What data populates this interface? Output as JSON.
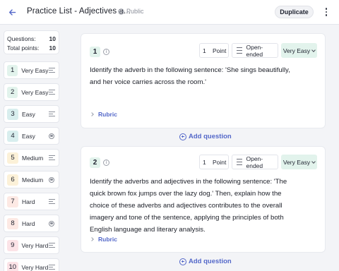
{
  "header": {
    "title": "Practice List - Adjectives a...",
    "visibility": "Public",
    "duplicate_label": "Duplicate"
  },
  "stats": {
    "questions_label": "Questions:",
    "questions_value": "10",
    "points_label": "Total points:",
    "points_value": "10"
  },
  "sidebar": {
    "items": [
      {
        "num": "1",
        "difficulty": "Very Easy",
        "icon": "lines-icon",
        "color": "#e2f3ec"
      },
      {
        "num": "2",
        "difficulty": "Very Easy",
        "icon": "lines-icon",
        "color": "#e2f3ec"
      },
      {
        "num": "3",
        "difficulty": "Easy",
        "icon": "lines-icon",
        "color": "#d8eeee"
      },
      {
        "num": "4",
        "difficulty": "Easy",
        "icon": "radio-icon",
        "color": "#d8eeee"
      },
      {
        "num": "5",
        "difficulty": "Medium",
        "icon": "lines-icon",
        "color": "#fcf1d8"
      },
      {
        "num": "6",
        "difficulty": "Medium",
        "icon": "radio-icon",
        "color": "#fcf1d8"
      },
      {
        "num": "7",
        "difficulty": "Hard",
        "icon": "lines-icon",
        "color": "#fde9e4"
      },
      {
        "num": "8",
        "difficulty": "Hard",
        "icon": "radio-icon",
        "color": "#fde9e4"
      },
      {
        "num": "9",
        "difficulty": "Very Hard",
        "icon": "lines-icon",
        "color": "#fce3e7"
      },
      {
        "num": "10",
        "difficulty": "Very Hard",
        "icon": "lines-icon",
        "color": "#fce3e7"
      }
    ]
  },
  "questions": [
    {
      "num": "1",
      "points_value": "1",
      "points_label": "Point",
      "type": "Open-ended",
      "difficulty": "Very Easy",
      "text": "Identify the adverb in the following sentence: 'She sings beautifully, and her voice carries across the room.'",
      "rubric_label": "Rubric"
    },
    {
      "num": "2",
      "points_value": "1",
      "points_label": "Point",
      "type": "Open-ended",
      "difficulty": "Very Easy",
      "text": "Identify the adverbs and adjectives in the following sentence: 'The quick brown fox jumps over the lazy dog.' Then, explain how the choice of these adverbs and adjectives contributes to the overall imagery and tone of the sentence, applying the principles of both English language and literary analysis.",
      "rubric_label": "Rubric"
    }
  ],
  "add_question_label": "Add question",
  "colors": {
    "accent": "#5468c9",
    "very_easy": "#e2f3ec",
    "easy": "#d8eeee",
    "medium": "#fcf1d8",
    "hard": "#fde9e4",
    "very_hard": "#fce3e7"
  }
}
